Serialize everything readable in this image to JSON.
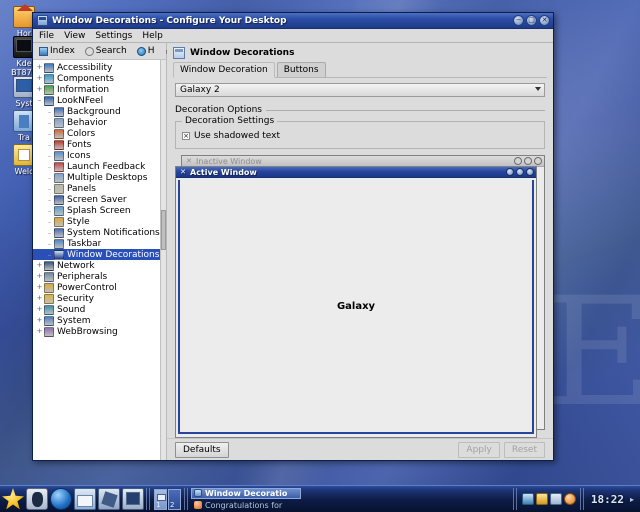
{
  "desktop": {
    "wallpaper_mark": "E",
    "accent_blue": "#2a50b8",
    "titlebar_blue": "#26459c",
    "panel_blue": "#0d1c45",
    "icons": [
      {
        "name": "home",
        "label": "Hor",
        "icon": "home-folder-icon"
      },
      {
        "name": "bt878",
        "label": "Kde\nBT878",
        "label_line1": "Kde",
        "label_line2": "BT878",
        "icon": "tv-card-icon"
      },
      {
        "name": "system",
        "label": "Syst",
        "icon": "system-monitor-icon"
      },
      {
        "name": "trash",
        "label": "Tra",
        "icon": "trash-icon"
      },
      {
        "name": "welcome",
        "label": "Welc",
        "icon": "welcome-document-icon"
      }
    ]
  },
  "window": {
    "title": "Window Decorations - Configure Your Desktop",
    "titlebar_icon": "kcontrol-icon",
    "buttons": [
      {
        "name": "minimize",
        "glyph": "−"
      },
      {
        "name": "maximize",
        "glyph": "□"
      },
      {
        "name": "close",
        "glyph": "✕"
      }
    ],
    "menus": [
      {
        "label": "File",
        "accel": "F"
      },
      {
        "label": "View",
        "accel": "V"
      },
      {
        "label": "Settings",
        "accel": "S"
      },
      {
        "label": "Help",
        "accel": "H"
      }
    ],
    "toolbar": [
      {
        "label": "Index",
        "icon": "index-icon"
      },
      {
        "label": "Search",
        "icon": "search-icon"
      },
      {
        "label": "H",
        "icon": "help-icon"
      }
    ],
    "toolbar_overflow": "▸"
  },
  "tree": {
    "selected": "Window Decorations",
    "items": [
      {
        "label": "Accessibility",
        "level": 0,
        "expandable": true,
        "icon_color": "#3a78c2"
      },
      {
        "label": "Components",
        "level": 0,
        "expandable": true,
        "icon_color": "#2f9bd0"
      },
      {
        "label": "Information",
        "level": 0,
        "expandable": true,
        "icon_color": "#4aa34a"
      },
      {
        "label": "LookNFeel",
        "level": 0,
        "expandable": true,
        "expanded": true,
        "icon_color": "#2f63b6"
      },
      {
        "label": "Background",
        "level": 1,
        "icon_color": "#3b6fb8"
      },
      {
        "label": "Behavior",
        "level": 1,
        "icon_color": "#7fa3cf"
      },
      {
        "label": "Colors",
        "level": 1,
        "icon_color": "#d06a3a"
      },
      {
        "label": "Fonts",
        "level": 1,
        "icon_color": "#c0392b"
      },
      {
        "label": "Icons",
        "level": 1,
        "icon_color": "#5a8fd0"
      },
      {
        "label": "Launch Feedback",
        "level": 1,
        "icon_color": "#cc4444"
      },
      {
        "label": "Multiple Desktops",
        "level": 1,
        "icon_color": "#7fa3cf"
      },
      {
        "label": "Panels",
        "level": 1,
        "icon_color": "#b9b9a0"
      },
      {
        "label": "Screen Saver",
        "level": 1,
        "icon_color": "#3d5fa8"
      },
      {
        "label": "Splash Screen",
        "level": 1,
        "icon_color": "#5aa0d0"
      },
      {
        "label": "Style",
        "level": 1,
        "icon_color": "#d8a93c"
      },
      {
        "label": "System Notifications",
        "level": 1,
        "icon_color": "#4a6fb8"
      },
      {
        "label": "Taskbar",
        "level": 1,
        "icon_color": "#4f86c4"
      },
      {
        "label": "Window Decorations",
        "level": 1,
        "icon_color": "#cfe0f5",
        "selected": true
      },
      {
        "label": "Network",
        "level": 0,
        "expandable": true,
        "icon_color": "#34567f"
      },
      {
        "label": "Peripherals",
        "level": 0,
        "expandable": true,
        "icon_color": "#6f8aa8"
      },
      {
        "label": "PowerControl",
        "level": 0,
        "expandable": true,
        "icon_color": "#d8a93c"
      },
      {
        "label": "Security",
        "level": 0,
        "expandable": true,
        "icon_color": "#e0b23c"
      },
      {
        "label": "Sound",
        "level": 0,
        "expandable": true,
        "icon_color": "#3d8fb0"
      },
      {
        "label": "System",
        "level": 0,
        "expandable": true,
        "icon_color": "#4a7ec0"
      },
      {
        "label": "WebBrowsing",
        "level": 0,
        "expandable": true,
        "icon_color": "#8f6fb0"
      }
    ]
  },
  "module": {
    "heading": "Window Decorations",
    "heading_icon": "window-decoration-icon",
    "tabs": [
      {
        "label": "Window Decoration",
        "accel": "W",
        "active": true
      },
      {
        "label": "Buttons",
        "accel": "B",
        "active": false
      }
    ],
    "decoration_combo": {
      "value": "Galaxy 2",
      "arrow_icon": "chevron-down-icon"
    },
    "options_group_label": "Decoration Options",
    "settings_group_label": "Decoration Settings",
    "settings": [
      {
        "label": "Use shadowed text",
        "accel": "t",
        "checked": true,
        "check_glyph": "×"
      }
    ]
  },
  "preview": {
    "inactive_window": {
      "title": "Inactive Window",
      "icon": "x-app-icon",
      "icon_glyph": "✕",
      "buttons": [
        {
          "name": "minimize",
          "glyph": "−"
        },
        {
          "name": "maximize",
          "glyph": "□"
        },
        {
          "name": "close",
          "glyph": "✕"
        }
      ]
    },
    "active_window": {
      "title": "Active Window",
      "icon": "x-app-icon",
      "icon_glyph": "✕",
      "body_text": "Galaxy",
      "buttons": [
        {
          "name": "minimize",
          "glyph": "−"
        },
        {
          "name": "maximize",
          "glyph": "□"
        },
        {
          "name": "close",
          "glyph": "✕"
        }
      ]
    }
  },
  "buttonbar": {
    "defaults": {
      "label": "Defaults",
      "accel": "D",
      "enabled": true
    },
    "apply": {
      "label": "Apply",
      "accel": "A",
      "enabled": false
    },
    "reset": {
      "label": "Reset",
      "accel": "R",
      "enabled": false
    }
  },
  "panel": {
    "launchers": [
      {
        "name": "kmenu",
        "icon": "kde-star-icon"
      },
      {
        "name": "show-desktop",
        "icon": "penguin-icon"
      },
      {
        "name": "konqueror",
        "icon": "globe-icon"
      },
      {
        "name": "kmail",
        "icon": "mail-icon"
      },
      {
        "name": "kpaint",
        "icon": "draw-icon"
      },
      {
        "name": "terminal",
        "icon": "screen-icon"
      }
    ],
    "pager": [
      {
        "number": "1",
        "active": true
      },
      {
        "number": "2",
        "active": false
      }
    ],
    "tasks": [
      {
        "label": "Window Decoratio",
        "icon": "kcontrol-icon",
        "active": true
      },
      {
        "label": "Congratulations for",
        "icon": "konqueror-icon",
        "active": false
      }
    ],
    "tray": [
      {
        "name": "klipper",
        "icon": "clipboard-icon"
      },
      {
        "name": "lock",
        "icon": "lock-icon"
      },
      {
        "name": "network",
        "icon": "network-icon"
      },
      {
        "name": "kmix",
        "icon": "volume-icon"
      }
    ],
    "clock": "18:22",
    "hide_arrow": "▸"
  }
}
